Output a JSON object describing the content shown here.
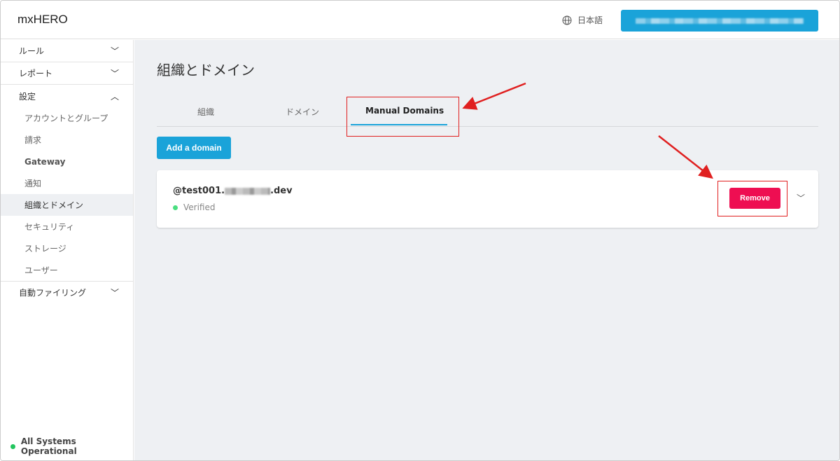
{
  "app": {
    "logo": "mxHERO",
    "language": "日本語",
    "user_button": "[blurred]"
  },
  "sidebar": {
    "sections": [
      {
        "label": "ルール",
        "expanded": false
      },
      {
        "label": "レポート",
        "expanded": false
      },
      {
        "label": "設定",
        "expanded": true
      },
      {
        "label": "自動ファイリング",
        "expanded": false
      }
    ],
    "settings_items": [
      "アカウントとグループ",
      "請求",
      "Gateway",
      "通知",
      "組織とドメイン",
      "セキュリティ",
      "ストレージ",
      "ユーザー"
    ],
    "status": "All Systems Operational"
  },
  "main": {
    "title": "組織とドメイン",
    "tabs": [
      "組織",
      "ドメイン",
      "Manual Domains"
    ],
    "add_button": "Add a domain",
    "domain": {
      "prefix": "@test001.",
      "suffix": ".dev",
      "status": "Verified",
      "remove_label": "Remove"
    }
  },
  "colors": {
    "accent": "#1aa3d9",
    "danger": "#ee0e52",
    "annotation": "#e02020"
  }
}
